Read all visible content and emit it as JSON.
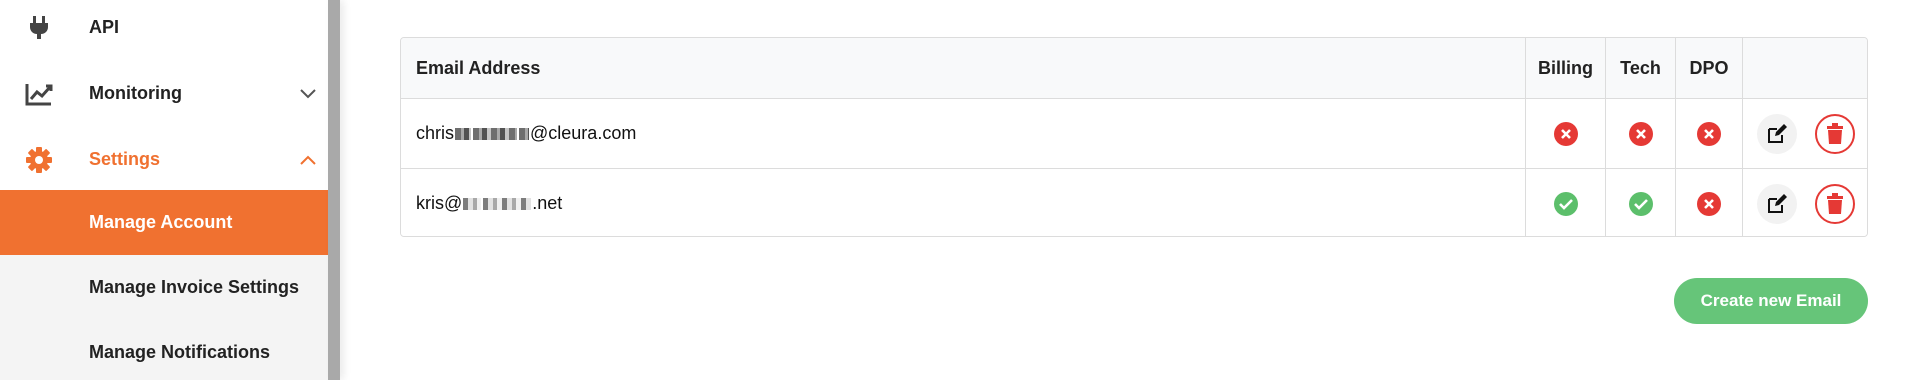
{
  "sidebar": {
    "items": [
      {
        "label": "API",
        "icon": "plug-icon"
      },
      {
        "label": "Monitoring",
        "icon": "chart-line-icon",
        "expanded": false
      },
      {
        "label": "Settings",
        "icon": "gear-icon",
        "expanded": true
      }
    ],
    "sub_items": [
      {
        "label": "Manage Account",
        "active": true
      },
      {
        "label": "Manage Invoice Settings",
        "active": false
      },
      {
        "label": "Manage Notifications",
        "active": false
      }
    ]
  },
  "table": {
    "headers": {
      "email": "Email Address",
      "billing": "Billing",
      "tech": "Tech",
      "dpo": "DPO"
    },
    "rows": [
      {
        "email_prefix": "chris",
        "email_suffix": "@cleura.com",
        "billing": false,
        "tech": false,
        "dpo": false
      },
      {
        "email_prefix": "kris@",
        "email_suffix": ".net",
        "billing": true,
        "tech": true,
        "dpo": false
      }
    ]
  },
  "actions": {
    "create_label": "Create new Email"
  },
  "colors": {
    "accent": "#f07130",
    "success": "#5cbf6b",
    "danger": "#e53935",
    "button_green": "#66c579"
  }
}
